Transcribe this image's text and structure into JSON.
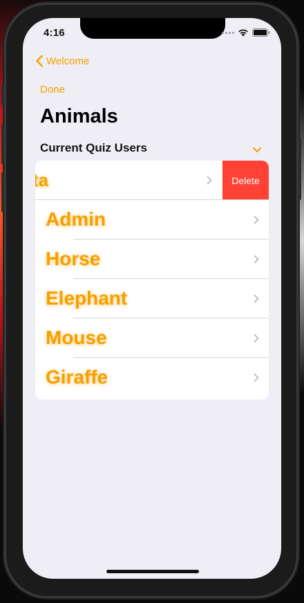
{
  "status_bar": {
    "time": "4:16"
  },
  "nav": {
    "back_label": "Welcome",
    "done_label": "Done"
  },
  "page": {
    "title": "Animals",
    "section_header": "Current Quiz Users"
  },
  "swiped_row": {
    "label_visible": "ta",
    "delete_label": "Delete"
  },
  "rows": [
    {
      "label": "Admin"
    },
    {
      "label": "Horse"
    },
    {
      "label": "Elephant"
    },
    {
      "label": "Mouse"
    },
    {
      "label": "Giraffe"
    }
  ],
  "colors": {
    "accent": "#f5a000",
    "delete": "#ff4233",
    "background": "#efeef4"
  },
  "icons": {
    "back": "chevron-left-icon",
    "section": "chevron-down-icon",
    "row": "chevron-right-icon"
  }
}
